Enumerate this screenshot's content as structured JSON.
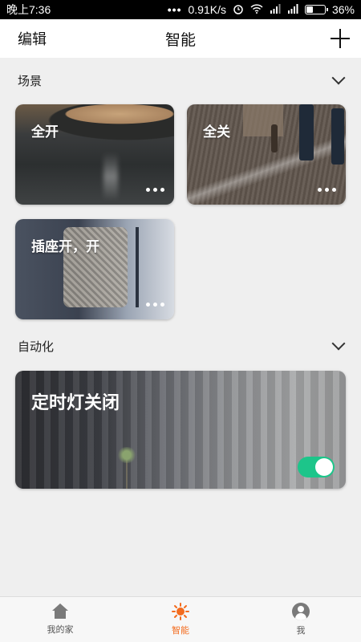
{
  "status_bar": {
    "time": "晚上7:36",
    "dots": "•••",
    "speed": "0.91K/s",
    "battery": "36%",
    "battery_level": 0.36
  },
  "header": {
    "edit_label": "编辑",
    "title": "智能",
    "add_icon": "plus-icon"
  },
  "scenes": {
    "label": "场景",
    "items": [
      {
        "name": "全开"
      },
      {
        "name": "全关"
      },
      {
        "name": "插座开，开"
      }
    ]
  },
  "automation": {
    "label": "自动化",
    "items": [
      {
        "name": "定时灯关闭",
        "enabled": true
      }
    ]
  },
  "colors": {
    "accent": "#f36c1f",
    "toggle_on": "#1dc58a"
  },
  "bottom_nav": {
    "items": [
      {
        "label": "我的家",
        "icon": "home-icon"
      },
      {
        "label": "智能",
        "icon": "sun-icon",
        "active": true
      },
      {
        "label": "我",
        "icon": "user-icon"
      }
    ]
  }
}
